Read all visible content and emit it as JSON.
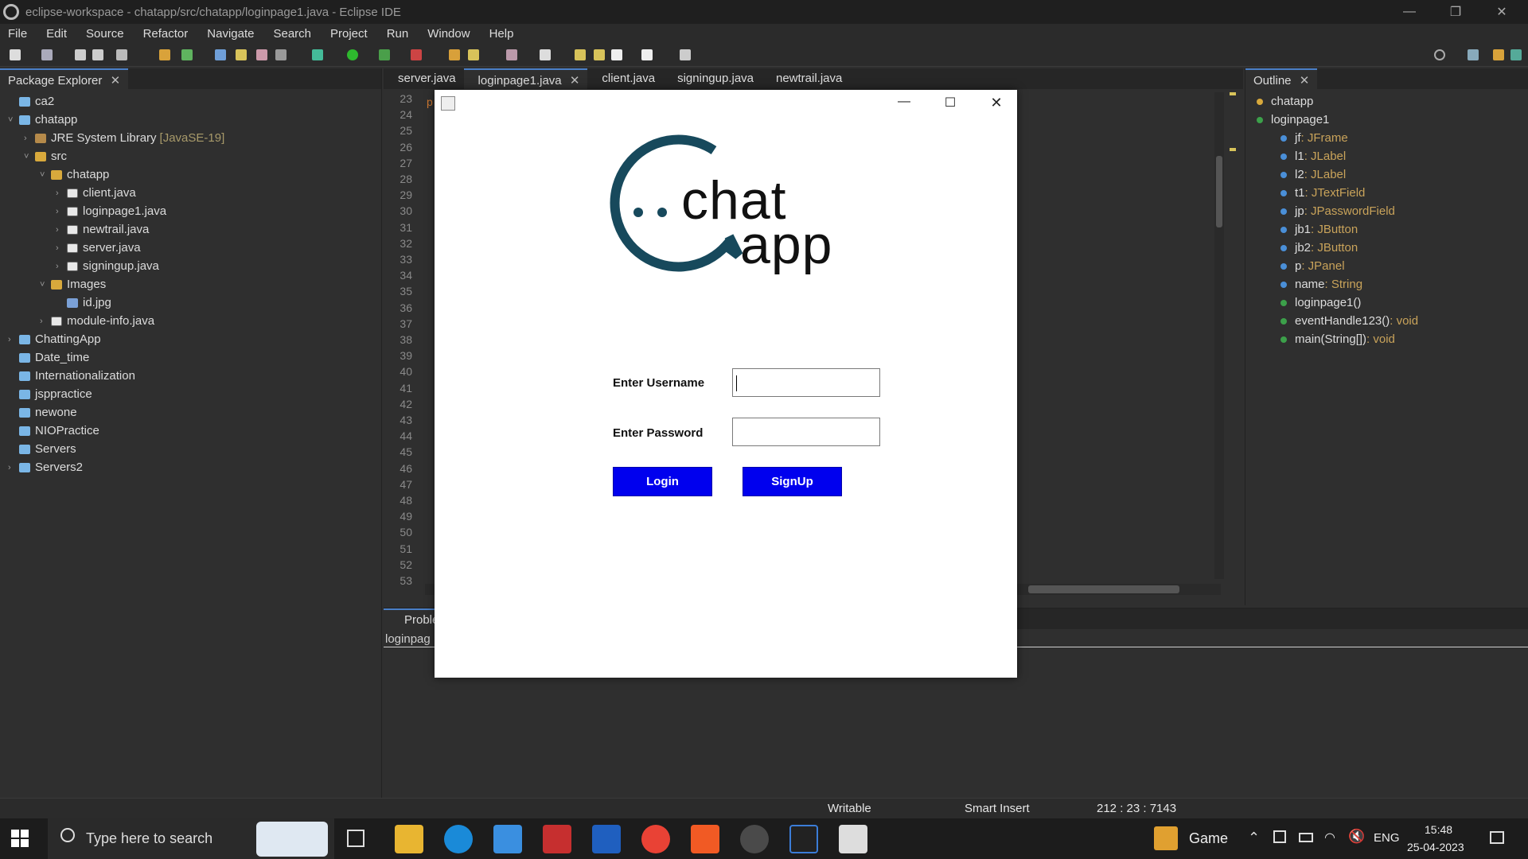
{
  "window": {
    "title": "eclipse-workspace - chatapp/src/chatapp/loginpage1.java - Eclipse IDE"
  },
  "menu": [
    "File",
    "Edit",
    "Source",
    "Refactor",
    "Navigate",
    "Search",
    "Project",
    "Run",
    "Window",
    "Help"
  ],
  "package_explorer": {
    "tab": "Package Explorer",
    "items": [
      {
        "label": "ca2",
        "depth": 0,
        "kind": "proj",
        "tw": ""
      },
      {
        "label": "chatapp",
        "depth": 0,
        "kind": "proj",
        "tw": "v"
      },
      {
        "label": "JRE System Library",
        "extra": "[JavaSE-19]",
        "depth": 1,
        "kind": "lib",
        "tw": ">"
      },
      {
        "label": "src",
        "depth": 1,
        "kind": "pkg",
        "tw": "v"
      },
      {
        "label": "chatapp",
        "depth": 2,
        "kind": "pkg",
        "tw": "v"
      },
      {
        "label": "client.java",
        "depth": 3,
        "kind": "jfile",
        "tw": ">"
      },
      {
        "label": "loginpage1.java",
        "depth": 3,
        "kind": "jfile",
        "tw": ">"
      },
      {
        "label": "newtrail.java",
        "depth": 3,
        "kind": "jfile",
        "tw": ">"
      },
      {
        "label": "server.java",
        "depth": 3,
        "kind": "jfile",
        "tw": ">"
      },
      {
        "label": "signingup.java",
        "depth": 3,
        "kind": "jfile",
        "tw": ">"
      },
      {
        "label": "Images",
        "depth": 2,
        "kind": "pkg",
        "tw": "v"
      },
      {
        "label": "id.jpg",
        "depth": 3,
        "kind": "fold",
        "tw": ""
      },
      {
        "label": "module-info.java",
        "depth": 2,
        "kind": "jfile",
        "tw": ">"
      },
      {
        "label": "ChattingApp",
        "depth": 0,
        "kind": "proj",
        "tw": ">"
      },
      {
        "label": "Date_time",
        "depth": 0,
        "kind": "proj",
        "tw": ""
      },
      {
        "label": "Internationalization",
        "depth": 0,
        "kind": "proj",
        "tw": ""
      },
      {
        "label": "jsppractice",
        "depth": 0,
        "kind": "proj",
        "tw": ""
      },
      {
        "label": "newone",
        "depth": 0,
        "kind": "proj",
        "tw": ""
      },
      {
        "label": "NIOPractice",
        "depth": 0,
        "kind": "proj",
        "tw": ""
      },
      {
        "label": "Servers",
        "depth": 0,
        "kind": "proj",
        "tw": ""
      },
      {
        "label": "Servers2",
        "depth": 0,
        "kind": "proj",
        "tw": ">"
      }
    ]
  },
  "editor": {
    "tabs": [
      "server.java",
      "loginpage1.java",
      "client.java",
      "signingup.java",
      "newtrail.java"
    ],
    "active_tab": "loginpage1.java",
    "line_numbers": [
      "23",
      "24",
      "25",
      "26",
      "27",
      "28",
      "29",
      "30",
      "31",
      "32",
      "33",
      "34",
      "35",
      "36",
      "37",
      "38",
      "39",
      "40",
      "41",
      "42",
      "43",
      "44",
      "45",
      "46",
      "47",
      "48",
      "49",
      "50",
      "51",
      "52",
      "53"
    ],
    "partial_code": "p"
  },
  "outline": {
    "tab": "Outline",
    "items": [
      {
        "label": "chatapp",
        "type": "",
        "depth": 0
      },
      {
        "label": "loginpage1",
        "type": "",
        "depth": 0
      },
      {
        "label": "jf",
        "type": " : JFrame",
        "depth": 1
      },
      {
        "label": "l1",
        "type": " : JLabel",
        "depth": 1
      },
      {
        "label": "l2",
        "type": " : JLabel",
        "depth": 1
      },
      {
        "label": "t1",
        "type": " : JTextField",
        "depth": 1
      },
      {
        "label": "jp",
        "type": " : JPasswordField",
        "depth": 1
      },
      {
        "label": "jb1",
        "type": " : JButton",
        "depth": 1
      },
      {
        "label": "jb2",
        "type": " : JButton",
        "depth": 1
      },
      {
        "label": "p",
        "type": " : JPanel",
        "depth": 1
      },
      {
        "label": "name",
        "type": " : String",
        "depth": 1
      },
      {
        "label": "loginpage1()",
        "type": "",
        "depth": 1
      },
      {
        "label": "eventHandle123()",
        "type": " : void",
        "depth": 1
      },
      {
        "label": "main(String[])",
        "type": " : void",
        "depth": 1
      }
    ]
  },
  "bottom_panel": {
    "tab": "Proble",
    "subtitle": "loginpag"
  },
  "dialog": {
    "logo_word1": "chat",
    "logo_word2": "app",
    "username_label": "Enter Username",
    "password_label": "Enter Password",
    "login_button": "Login",
    "signup_button": "SignUp"
  },
  "status": {
    "writable": "Writable",
    "insert_mode": "Smart Insert",
    "position": "212 : 23 : 7143"
  },
  "taskbar": {
    "search_placeholder": "Type here to search",
    "game": "Game",
    "lang": "ENG",
    "time": "15:48",
    "date": "25-04-2023"
  }
}
